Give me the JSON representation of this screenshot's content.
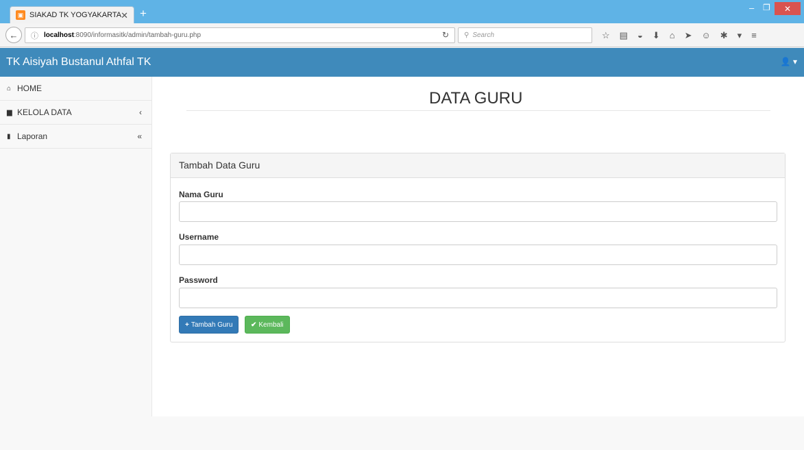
{
  "browser": {
    "tab_title": "SIAKAD TK YOGYAKARTA",
    "url_host": "localhost",
    "url_path": ":8090/informasitk/admin/tambah-guru.php",
    "search_placeholder": "Search"
  },
  "app": {
    "brand": "TK Aisiyah Bustanul Athfal TK"
  },
  "sidebar": {
    "items": [
      {
        "label": "HOME"
      },
      {
        "label": "KELOLA DATA"
      },
      {
        "label": "Laporan"
      }
    ]
  },
  "page": {
    "title": "DATA GURU"
  },
  "form": {
    "heading": "Tambah Data Guru",
    "fields": [
      {
        "label": "Nama Guru",
        "value": ""
      },
      {
        "label": "Username",
        "value": ""
      },
      {
        "label": "Password",
        "value": ""
      }
    ],
    "submit_label": "Tambah Guru",
    "back_label": "Kembali"
  },
  "colors": {
    "header": "#3f8abb",
    "primary": "#337ab7",
    "success": "#5cb85c"
  }
}
